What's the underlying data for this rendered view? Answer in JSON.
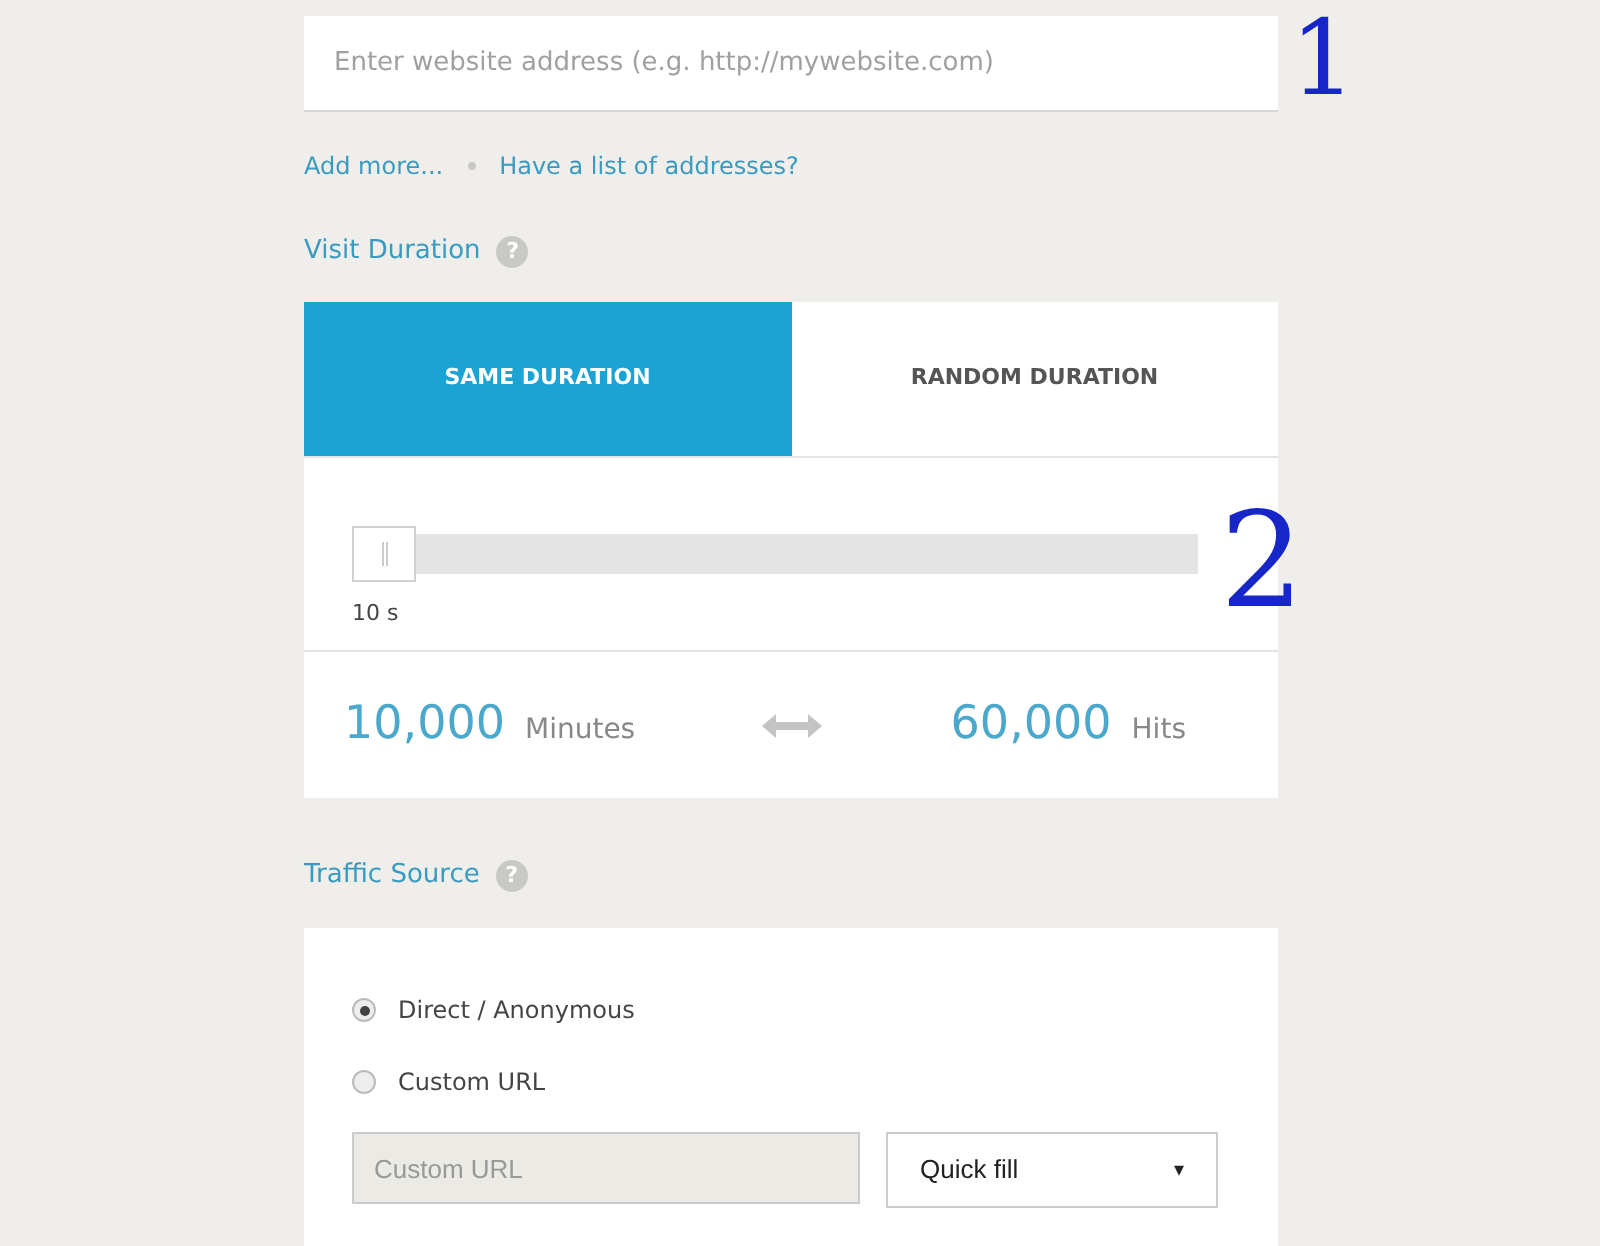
{
  "website_field": {
    "placeholder": "Enter website address (e.g. http://mywebsite.com)"
  },
  "links": [
    "Add more...",
    "Have a list of addresses?"
  ],
  "visit_duration": {
    "title": "Visit Duration",
    "help": "?",
    "tabs": [
      {
        "label": "SAME DURATION",
        "selected": true
      },
      {
        "label": "RANDOM DURATION",
        "selected": false
      }
    ],
    "slider": {
      "reading": "10 s"
    },
    "stats": [
      {
        "value": "10,000",
        "unit": "Minutes"
      },
      {
        "value": "60,000",
        "unit": "Hits"
      }
    ]
  },
  "traffic_source": {
    "title": "Traffic Source",
    "help": "?",
    "options": [
      {
        "label": "Direct / Anonymous",
        "selected": true
      },
      {
        "label": "Custom URL",
        "selected": false
      }
    ],
    "custom_url": {
      "placeholder": "Custom URL",
      "disabled": true
    },
    "quick_fill": {
      "value": "Quick fill",
      "caret": "▾"
    }
  },
  "annotations": [
    "1",
    "2"
  ]
}
